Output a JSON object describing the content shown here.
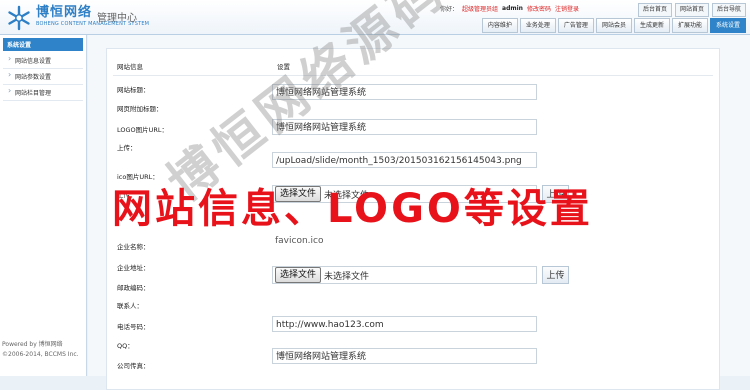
{
  "header": {
    "brand_cn": "博恒网络",
    "brand_en": "BOHENG CONTENT MANAGEMENT SYSTEM",
    "mgmt_title": "管理中心",
    "greeting": "你好：",
    "role": "超级管理员组",
    "username": "admin",
    "edit_password": "修改密码",
    "logout": "注销登录",
    "top_buttons": [
      "后台首页",
      "网站首页",
      "后台导航"
    ],
    "nav_tabs": [
      "内容维护",
      "业务处理",
      "广告管理",
      "网站会员",
      "生成更新",
      "扩展功能",
      "系统设置"
    ],
    "active_tab": "系统设置"
  },
  "sidebar": {
    "title": "系统设置",
    "items": [
      {
        "label": "网站信息设置"
      },
      {
        "label": "网站参数设置"
      },
      {
        "label": "网站栏目管理"
      }
    ],
    "footer_line1": "Powered by 博恒网络",
    "footer_line2": "©2006-2014, BCCMS Inc."
  },
  "form": {
    "col_info": "网站信息",
    "col_settings": "设置",
    "site_title_label": "网站标题：",
    "site_title_value": "博恒网络网站管理系统",
    "extra_title_label": "网页附加标题：",
    "logo_url_label": "LOGO图片URL：",
    "logo_url_value": "博恒网络网站管理系统",
    "upload_label": "上传：",
    "logo_path": "/upLoad/slide/month_1503/201503162156145043.png",
    "ico_url_label": "ico图片URL：",
    "ico_upload_label": "上传：",
    "choose_file": "选择文件",
    "no_file": "未选择文件",
    "upload_button": "上传",
    "ico_value": "favicon.ico",
    "company_name_label": "企业名称：",
    "company_address_label": "企业地址：",
    "postcode_label": "邮政编码：",
    "contact_label": "联系人：",
    "phone_label": "电话号码：",
    "phone_value": "http://www.hao123.com",
    "qq_label": "QQ：",
    "qq_value": "博恒网络网站管理系统",
    "fax_label": "公司传真："
  },
  "overlay": {
    "banner": "网站信息、LOGO等设置",
    "watermark": "博恒网络源码专用"
  },
  "colors": {
    "accent": "#2f84c9",
    "banner_red": "#e8121b",
    "page_bg": "#eaf1f7"
  }
}
